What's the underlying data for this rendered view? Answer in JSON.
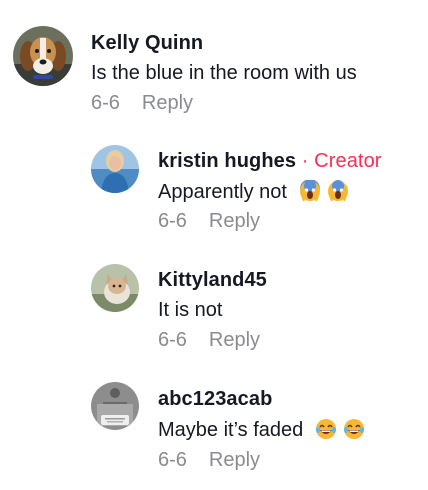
{
  "comments": [
    {
      "avatar": "beagle-dog-avatar",
      "name": "Kelly Quinn",
      "badge": "",
      "text": "Is the blue in the room with us",
      "emojis": [],
      "date": "6-6",
      "reply_label": "Reply"
    },
    {
      "avatar": "woman-blonde-avatar",
      "name": "kristin hughes",
      "badge": "· Creator",
      "text": "Apparently not",
      "emojis": [
        "screaming-face-emoji",
        "screaming-face-emoji"
      ],
      "date": "6-6",
      "reply_label": "Reply"
    },
    {
      "avatar": "cat-avatar",
      "name": "Kittyland45",
      "badge": "",
      "text": "It is not",
      "emojis": [],
      "date": "6-6",
      "reply_label": "Reply"
    },
    {
      "avatar": "grey-profile-avatar",
      "name": "abc123acab",
      "badge": "",
      "text": "Maybe it’s faded",
      "emojis": [
        "laughing-face-emoji",
        "laughing-face-emoji"
      ],
      "date": "6-6",
      "reply_label": "Reply"
    }
  ],
  "colors": {
    "creator": "#fe2c55",
    "meta": "#8a8b91",
    "text": "#161823"
  }
}
